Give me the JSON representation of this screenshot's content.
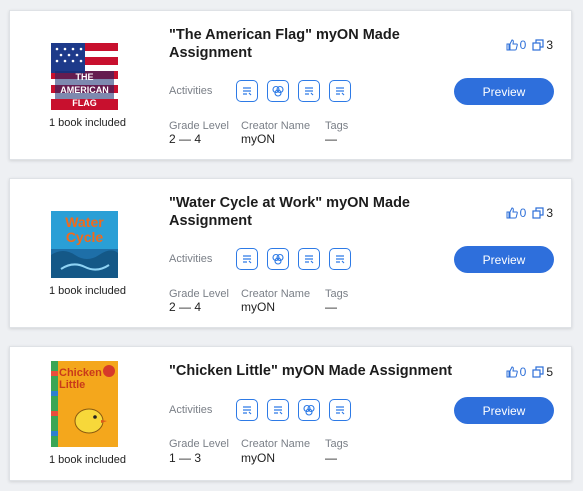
{
  "cards": [
    {
      "title": "\"The American Flag\" myON Made Assignment",
      "cover_text": "THE AMERICAN FLAG",
      "included": "1 book included",
      "activities_label": "Activities",
      "activity_icons": [
        "activity-doc-icon",
        "activity-circles-icon",
        "activity-doc-icon",
        "activity-doc-icon"
      ],
      "grade_label": "Grade Level",
      "grade_value": "2 — 4",
      "creator_label": "Creator Name",
      "creator_value": "myON",
      "tags_label": "Tags",
      "tags_value": "—",
      "likes": "0",
      "copies": "3",
      "preview_label": "Preview"
    },
    {
      "title": "\"Water Cycle at Work\" myON Made Assignment",
      "cover_text": "Water Cycle",
      "included": "1 book included",
      "activities_label": "Activities",
      "activity_icons": [
        "activity-doc-icon",
        "activity-circles-icon",
        "activity-doc-icon",
        "activity-doc-icon"
      ],
      "grade_label": "Grade Level",
      "grade_value": "2 — 4",
      "creator_label": "Creator Name",
      "creator_value": "myON",
      "tags_label": "Tags",
      "tags_value": "—",
      "likes": "0",
      "copies": "3",
      "preview_label": "Preview"
    },
    {
      "title": "\"Chicken Little\" myON Made Assignment",
      "cover_text": "Chicken Little",
      "included": "1 book included",
      "activities_label": "Activities",
      "activity_icons": [
        "activity-doc-icon",
        "activity-doc-icon",
        "activity-circles-icon",
        "activity-doc-icon"
      ],
      "grade_label": "Grade Level",
      "grade_value": "1 — 3",
      "creator_label": "Creator Name",
      "creator_value": "myON",
      "tags_label": "Tags",
      "tags_value": "—",
      "likes": "0",
      "copies": "5",
      "preview_label": "Preview"
    }
  ],
  "colors": {
    "accent": "#2e6fdc",
    "icon_blue": "#2d7ae6",
    "label_gray": "#7a7f87"
  }
}
